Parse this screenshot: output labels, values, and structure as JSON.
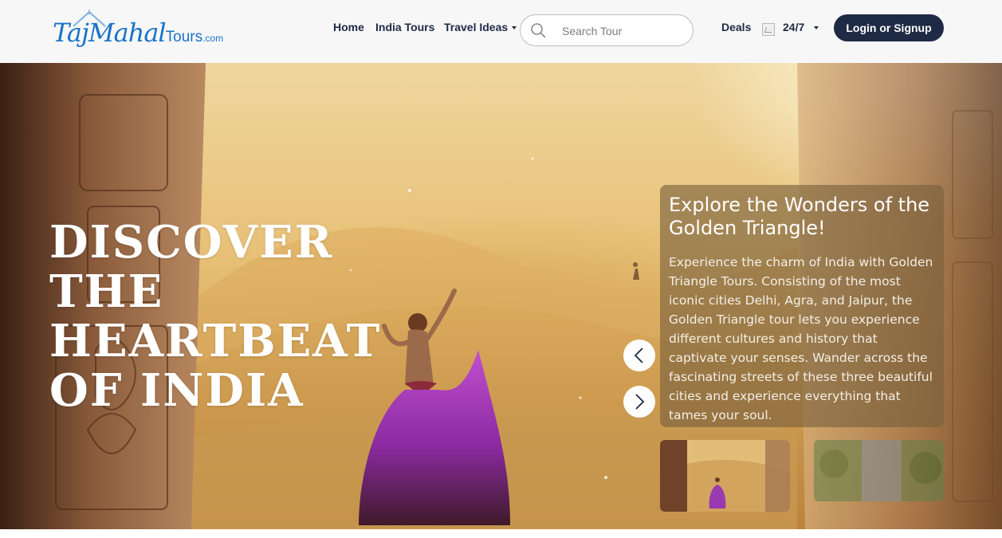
{
  "header": {
    "logo": {
      "main": "TajMahal",
      "tours": "Tours",
      "com": ".com"
    },
    "nav": {
      "home": "Home",
      "india_tours": "India Tours",
      "travel_ideas": "Travel Ideas",
      "deals": "Deals",
      "support": "24/7"
    },
    "search": {
      "placeholder": "Search Tour"
    },
    "login_label": "Login or Signup"
  },
  "hero": {
    "title": "DISCOVER THE HEARTBEAT OF INDIA",
    "card": {
      "title": "Explore the Wonders of the Golden Triangle!",
      "description": "Experience the charm of India with Golden Triangle Tours. Consisting of the most iconic cities Delhi, Agra, and Jaipur, the Golden Triangle tour lets you experience different cultures and history that captivate your senses. Wander across the fascinating streets of these three beautiful cities and experience everything that tames your soul."
    }
  },
  "colors": {
    "brand_blue": "#1a73c8",
    "nav_text": "#1f2a44",
    "button_bg": "#1f2a44",
    "header_bg": "#f7f7f7"
  },
  "icons": {
    "search": "search-icon",
    "prev": "chevron-left-icon",
    "next": "chevron-right-icon",
    "dropdown": "caret-down-icon"
  }
}
